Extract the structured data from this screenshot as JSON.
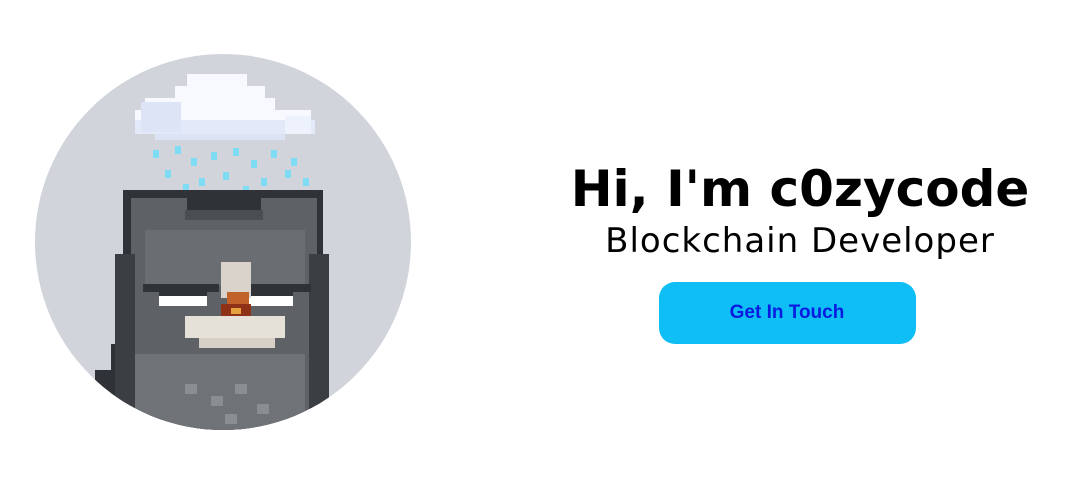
{
  "hero": {
    "greeting": "Hi, I'm c0zycode",
    "role": "Blockchain Developer",
    "cta_label": "Get In Touch"
  },
  "avatar": {
    "icon": "pixel-cat-rain-cloud-icon"
  },
  "colors": {
    "cta_background": "#0ebef4",
    "cta_text": "#0a1be0",
    "avatar_background": "#d1d5db",
    "fur_dark": "#3b3e43",
    "fur_mid": "#5e6166",
    "fur_light": "#7c7f84",
    "cloud": "#f5f7fc",
    "rain": "#7fdcf5"
  }
}
